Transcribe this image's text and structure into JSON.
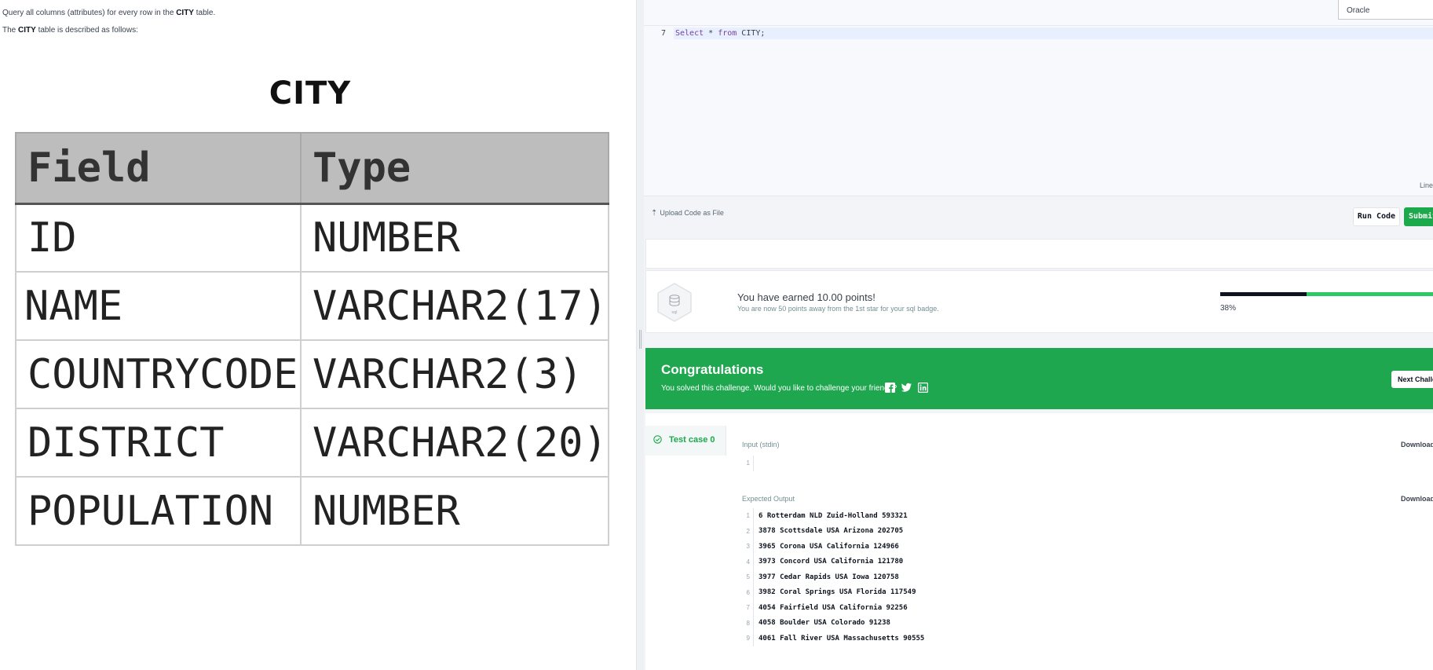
{
  "problem": {
    "desc1_prefix": "Query all columns (attributes) for every row in the ",
    "desc1_bold": "CITY",
    "desc1_suffix": " table.",
    "desc2_prefix": "The ",
    "desc2_bold": "CITY",
    "desc2_suffix": " table is described as follows:",
    "table_title": "CITY",
    "headers": [
      "Field",
      "Type"
    ],
    "rows": [
      [
        "ID",
        "NUMBER"
      ],
      [
        "NAME",
        "VARCHAR2(17)"
      ],
      [
        "COUNTRYCODE",
        "VARCHAR2(3)"
      ],
      [
        "DISTRICT",
        "VARCHAR2(20)"
      ],
      [
        "POPULATION",
        "NUMBER"
      ]
    ]
  },
  "editor": {
    "language": "Oracle",
    "line_number": "7",
    "code_kw1": "Select",
    "code_mid": " * ",
    "code_kw2": "from",
    "code_rest": " CITY;",
    "line_info": "Line"
  },
  "actions": {
    "upload_label": "Upload Code as File",
    "run_label": "Run Code",
    "submit_label": "Submit Code"
  },
  "points": {
    "main": "You have earned 10.00 points!",
    "sub": "You are now 50 points away from the 1st star for your sql badge.",
    "badge_text": "sql",
    "progress_fraction": 0.38,
    "progress_label": "38%"
  },
  "congrats": {
    "title": "Congratulations",
    "sub": "You solved this challenge. Would you like to challenge your friends?",
    "next_label": "Next Challenge"
  },
  "results": {
    "test_case_label": "Test case 0",
    "input_label": "Input (stdin)",
    "download_label": "Download",
    "input_lines": [
      ""
    ],
    "expected_label": "Expected Output",
    "expected_lines": [
      "6 Rotterdam NLD Zuid-Holland 593321",
      "3878 Scottsdale USA Arizona 202705",
      "3965 Corona USA California 124966",
      "3973 Concord USA California 121780",
      "3977 Cedar Rapids USA Iowa 120758",
      "3982 Coral Springs USA Florida 117549",
      "4054 Fairfield USA California 92256",
      "4058 Boulder USA Colorado 91238",
      "4061 Fall River USA Massachusetts 90555"
    ]
  },
  "colors": {
    "success_green": "#1ba94c",
    "congrats_green": "#1fa74f",
    "dark": "#0e141e"
  }
}
